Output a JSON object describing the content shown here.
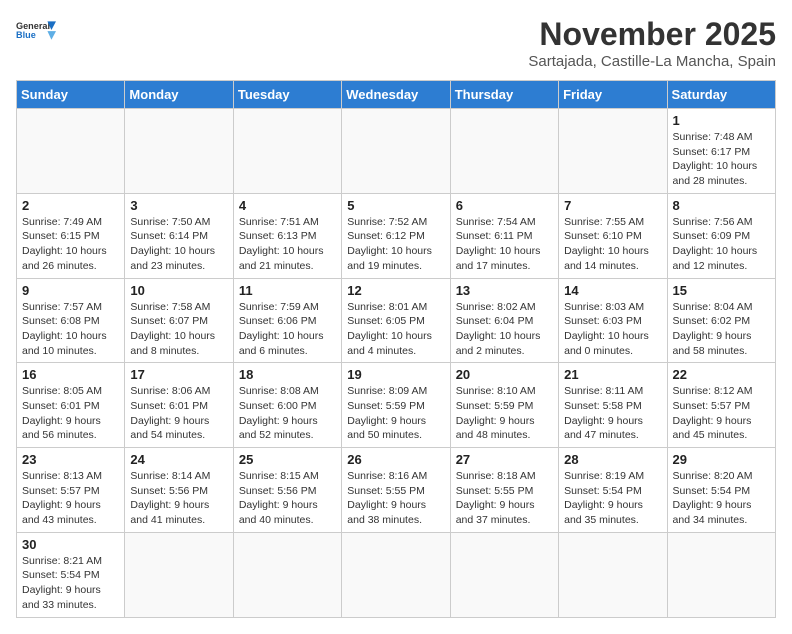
{
  "header": {
    "logo_line1": "General",
    "logo_line2": "Blue",
    "month_title": "November 2025",
    "location": "Sartajada, Castille-La Mancha, Spain"
  },
  "weekdays": [
    "Sunday",
    "Monday",
    "Tuesday",
    "Wednesday",
    "Thursday",
    "Friday",
    "Saturday"
  ],
  "weeks": [
    [
      {
        "day": "",
        "info": ""
      },
      {
        "day": "",
        "info": ""
      },
      {
        "day": "",
        "info": ""
      },
      {
        "day": "",
        "info": ""
      },
      {
        "day": "",
        "info": ""
      },
      {
        "day": "",
        "info": ""
      },
      {
        "day": "1",
        "info": "Sunrise: 7:48 AM\nSunset: 6:17 PM\nDaylight: 10 hours\nand 28 minutes."
      }
    ],
    [
      {
        "day": "2",
        "info": "Sunrise: 7:49 AM\nSunset: 6:15 PM\nDaylight: 10 hours\nand 26 minutes."
      },
      {
        "day": "3",
        "info": "Sunrise: 7:50 AM\nSunset: 6:14 PM\nDaylight: 10 hours\nand 23 minutes."
      },
      {
        "day": "4",
        "info": "Sunrise: 7:51 AM\nSunset: 6:13 PM\nDaylight: 10 hours\nand 21 minutes."
      },
      {
        "day": "5",
        "info": "Sunrise: 7:52 AM\nSunset: 6:12 PM\nDaylight: 10 hours\nand 19 minutes."
      },
      {
        "day": "6",
        "info": "Sunrise: 7:54 AM\nSunset: 6:11 PM\nDaylight: 10 hours\nand 17 minutes."
      },
      {
        "day": "7",
        "info": "Sunrise: 7:55 AM\nSunset: 6:10 PM\nDaylight: 10 hours\nand 14 minutes."
      },
      {
        "day": "8",
        "info": "Sunrise: 7:56 AM\nSunset: 6:09 PM\nDaylight: 10 hours\nand 12 minutes."
      }
    ],
    [
      {
        "day": "9",
        "info": "Sunrise: 7:57 AM\nSunset: 6:08 PM\nDaylight: 10 hours\nand 10 minutes."
      },
      {
        "day": "10",
        "info": "Sunrise: 7:58 AM\nSunset: 6:07 PM\nDaylight: 10 hours\nand 8 minutes."
      },
      {
        "day": "11",
        "info": "Sunrise: 7:59 AM\nSunset: 6:06 PM\nDaylight: 10 hours\nand 6 minutes."
      },
      {
        "day": "12",
        "info": "Sunrise: 8:01 AM\nSunset: 6:05 PM\nDaylight: 10 hours\nand 4 minutes."
      },
      {
        "day": "13",
        "info": "Sunrise: 8:02 AM\nSunset: 6:04 PM\nDaylight: 10 hours\nand 2 minutes."
      },
      {
        "day": "14",
        "info": "Sunrise: 8:03 AM\nSunset: 6:03 PM\nDaylight: 10 hours\nand 0 minutes."
      },
      {
        "day": "15",
        "info": "Sunrise: 8:04 AM\nSunset: 6:02 PM\nDaylight: 9 hours\nand 58 minutes."
      }
    ],
    [
      {
        "day": "16",
        "info": "Sunrise: 8:05 AM\nSunset: 6:01 PM\nDaylight: 9 hours\nand 56 minutes."
      },
      {
        "day": "17",
        "info": "Sunrise: 8:06 AM\nSunset: 6:01 PM\nDaylight: 9 hours\nand 54 minutes."
      },
      {
        "day": "18",
        "info": "Sunrise: 8:08 AM\nSunset: 6:00 PM\nDaylight: 9 hours\nand 52 minutes."
      },
      {
        "day": "19",
        "info": "Sunrise: 8:09 AM\nSunset: 5:59 PM\nDaylight: 9 hours\nand 50 minutes."
      },
      {
        "day": "20",
        "info": "Sunrise: 8:10 AM\nSunset: 5:59 PM\nDaylight: 9 hours\nand 48 minutes."
      },
      {
        "day": "21",
        "info": "Sunrise: 8:11 AM\nSunset: 5:58 PM\nDaylight: 9 hours\nand 47 minutes."
      },
      {
        "day": "22",
        "info": "Sunrise: 8:12 AM\nSunset: 5:57 PM\nDaylight: 9 hours\nand 45 minutes."
      }
    ],
    [
      {
        "day": "23",
        "info": "Sunrise: 8:13 AM\nSunset: 5:57 PM\nDaylight: 9 hours\nand 43 minutes."
      },
      {
        "day": "24",
        "info": "Sunrise: 8:14 AM\nSunset: 5:56 PM\nDaylight: 9 hours\nand 41 minutes."
      },
      {
        "day": "25",
        "info": "Sunrise: 8:15 AM\nSunset: 5:56 PM\nDaylight: 9 hours\nand 40 minutes."
      },
      {
        "day": "26",
        "info": "Sunrise: 8:16 AM\nSunset: 5:55 PM\nDaylight: 9 hours\nand 38 minutes."
      },
      {
        "day": "27",
        "info": "Sunrise: 8:18 AM\nSunset: 5:55 PM\nDaylight: 9 hours\nand 37 minutes."
      },
      {
        "day": "28",
        "info": "Sunrise: 8:19 AM\nSunset: 5:54 PM\nDaylight: 9 hours\nand 35 minutes."
      },
      {
        "day": "29",
        "info": "Sunrise: 8:20 AM\nSunset: 5:54 PM\nDaylight: 9 hours\nand 34 minutes."
      }
    ],
    [
      {
        "day": "30",
        "info": "Sunrise: 8:21 AM\nSunset: 5:54 PM\nDaylight: 9 hours\nand 33 minutes."
      },
      {
        "day": "",
        "info": ""
      },
      {
        "day": "",
        "info": ""
      },
      {
        "day": "",
        "info": ""
      },
      {
        "day": "",
        "info": ""
      },
      {
        "day": "",
        "info": ""
      },
      {
        "day": "",
        "info": ""
      }
    ]
  ]
}
